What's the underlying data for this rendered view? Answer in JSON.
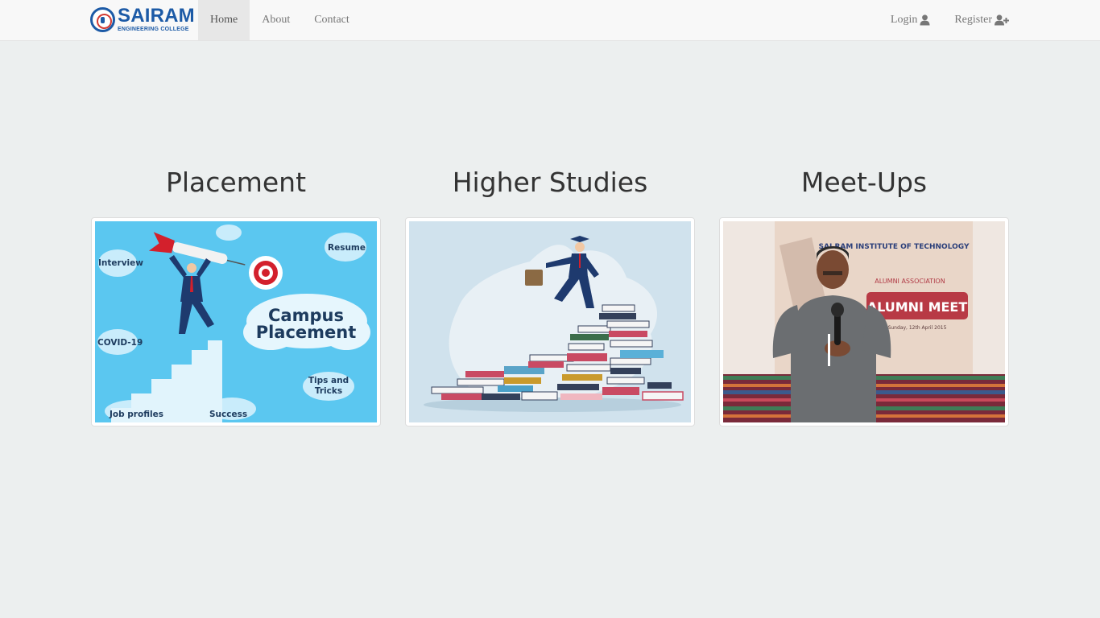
{
  "brand": {
    "name": "SAIRAM",
    "subtitle": "ENGINEERING COLLEGE"
  },
  "nav": {
    "left": [
      {
        "label": "Home",
        "active": true
      },
      {
        "label": "About",
        "active": false
      },
      {
        "label": "Contact",
        "active": false
      }
    ],
    "right": [
      {
        "label": "Login",
        "icon": "user-icon"
      },
      {
        "label": "Register",
        "icon": "user-plus-icon"
      }
    ]
  },
  "cards": [
    {
      "title": "Placement",
      "image": {
        "heading_line1": "Campus",
        "heading_line2": "Placement",
        "tags": [
          "Interview",
          "Resume",
          "COVID-19",
          "Tips and",
          "Tricks",
          "Job profiles",
          "Success"
        ]
      }
    },
    {
      "title": "Higher Studies"
    },
    {
      "title": "Meet-Ups",
      "image": {
        "banner_title": "SAI RAM INSTITUTE OF TECHNOLOGY",
        "banner_line": "ALUMNI ASSOCIATION",
        "banner_heading": "ALUMNI MEET",
        "banner_date": "Sunday, 12th April 2015"
      }
    }
  ],
  "colors": {
    "navbar_bg": "#f8f8f8",
    "page_bg": "#ecefef",
    "brand_blue": "#1c5aa6",
    "placement_bg": "#5bc7f0"
  }
}
